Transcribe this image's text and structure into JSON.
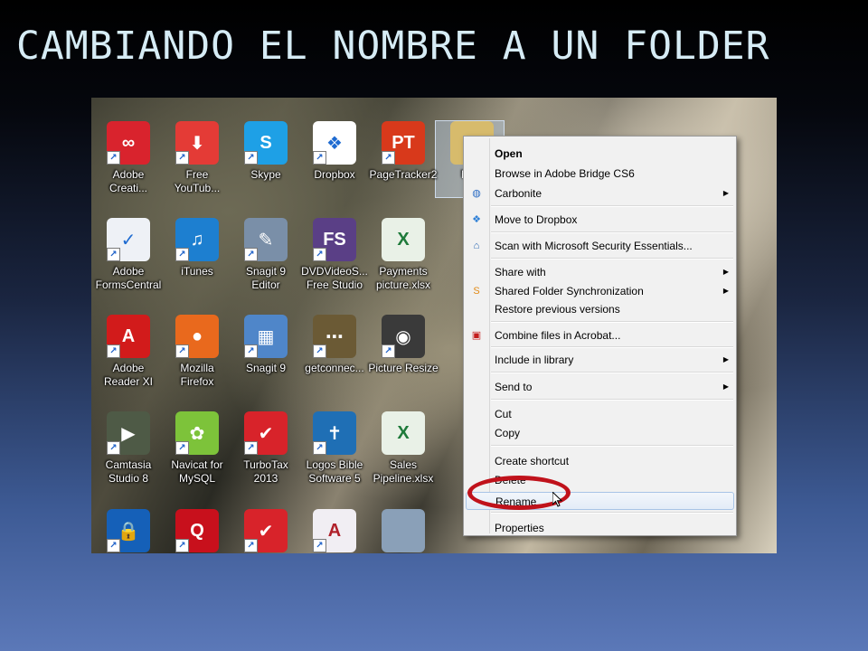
{
  "slide": {
    "title": "CAMBIANDO EL NOMBRE A UN FOLDER"
  },
  "colors": {
    "title": "#d6ecf5",
    "highlight_oval": "#c0121b",
    "menu_hover": "#e3ecf7"
  },
  "desktop": {
    "icons": [
      {
        "label": "Adobe\nCreati...",
        "icon": "creative-cloud-icon",
        "color": "#d9232d",
        "glyph": "∞"
      },
      {
        "label": "Free\nYouTub...",
        "icon": "download-arrow-icon",
        "color": "#e43b36",
        "glyph": "⬇"
      },
      {
        "label": "Skype",
        "icon": "skype-icon",
        "color": "#1ea0e6",
        "glyph": "S"
      },
      {
        "label": "Dropbox",
        "icon": "dropbox-icon",
        "color": "#ffffff",
        "glyph": "❖"
      },
      {
        "label": "PageTracker2",
        "icon": "pagetracker-icon",
        "color": "#d8391b",
        "glyph": "PT"
      },
      {
        "label": "New",
        "icon": "folder-icon",
        "color": "#d7bb6c",
        "glyph": ""
      },
      {
        "label": "Adobe\nFormsCentral",
        "icon": "forms-central-icon",
        "color": "#eef1f6",
        "glyph": "✓"
      },
      {
        "label": "iTunes",
        "icon": "itunes-icon",
        "color": "#1d7fd0",
        "glyph": "♫"
      },
      {
        "label": "Snagit 9\nEditor",
        "icon": "snagit-editor-icon",
        "color": "#7a8fa8",
        "glyph": "✎"
      },
      {
        "label": "DVDVideoS...\nFree Studio",
        "icon": "dvdvideosoft-icon",
        "color": "#5a3f86",
        "glyph": "FS"
      },
      {
        "label": "Payments\npicture.xlsx",
        "icon": "excel-file-icon",
        "color": "#e9f1e7",
        "glyph": "X"
      },
      {
        "label": "Adobe\nReader XI",
        "icon": "adobe-reader-icon",
        "color": "#d21b1b",
        "glyph": "A"
      },
      {
        "label": "Mozilla\nFirefox",
        "icon": "firefox-icon",
        "color": "#e9691d",
        "glyph": "●"
      },
      {
        "label": "Snagit 9",
        "icon": "snagit-icon",
        "color": "#4f86c9",
        "glyph": "▦"
      },
      {
        "label": "getconnec...",
        "icon": "getconnected-icon",
        "color": "#6b5a35",
        "glyph": "⋯"
      },
      {
        "label": "Picture Resize",
        "icon": "camera-icon",
        "color": "#3a3a3a",
        "glyph": "◉"
      },
      {
        "label": "Camtasia\nStudio 8",
        "icon": "camtasia-icon",
        "color": "#4e5a46",
        "glyph": "▶"
      },
      {
        "label": "Navicat for\nMySQL",
        "icon": "navicat-icon",
        "color": "#7dc33a",
        "glyph": "✿"
      },
      {
        "label": "TurboTax\n2013",
        "icon": "turbotax-icon",
        "color": "#d8232a",
        "glyph": "✔"
      },
      {
        "label": "Logos Bible\nSoftware 5",
        "icon": "logos-bible-icon",
        "color": "#1f6fb5",
        "glyph": "✝"
      },
      {
        "label": "Sales\nPipeline.xlsx",
        "icon": "excel-file-icon",
        "color": "#e9f1e7",
        "glyph": "X"
      },
      {
        "label": "",
        "icon": "lock-icon",
        "color": "#1560b8",
        "glyph": "🔒"
      },
      {
        "label": "",
        "icon": "quicken-icon",
        "color": "#c8101c",
        "glyph": "Q"
      },
      {
        "label": "",
        "icon": "turbotax-icon",
        "color": "#d8232a",
        "glyph": "✔"
      },
      {
        "label": "",
        "icon": "access-file-icon",
        "color": "#f1eef3",
        "glyph": "A"
      },
      {
        "label": "",
        "icon": "image-file-icon",
        "color": "#8aa0b8",
        "glyph": ""
      }
    ]
  },
  "context_menu": {
    "items": [
      {
        "label": "Open",
        "bold": true
      },
      {
        "label": "Browse in Adobe Bridge CS6"
      },
      {
        "label": "Carbonite",
        "icon": "carbonite-icon",
        "submenu": true
      },
      {
        "separator": true
      },
      {
        "label": "Move to Dropbox",
        "icon": "dropbox-icon"
      },
      {
        "separator": true
      },
      {
        "label": "Scan with Microsoft Security Essentials...",
        "icon": "security-essentials-icon"
      },
      {
        "separator": true
      },
      {
        "label": "Share with",
        "submenu": true
      },
      {
        "label": "Shared Folder Synchronization",
        "icon": "sync-icon",
        "submenu": true
      },
      {
        "label": "Restore previous versions"
      },
      {
        "separator": true
      },
      {
        "label": "Combine files in Acrobat...",
        "icon": "acrobat-icon"
      },
      {
        "separator": true
      },
      {
        "label": "Include in library",
        "submenu": true
      },
      {
        "separator": true
      },
      {
        "label": "Send to",
        "submenu": true
      },
      {
        "separator": true
      },
      {
        "label": "Cut"
      },
      {
        "label": "Copy"
      },
      {
        "separator": true
      },
      {
        "label": "Create shortcut"
      },
      {
        "label": "Delete"
      },
      {
        "label": "Rename",
        "highlighted": true
      },
      {
        "separator": true
      },
      {
        "label": "Properties"
      }
    ]
  }
}
